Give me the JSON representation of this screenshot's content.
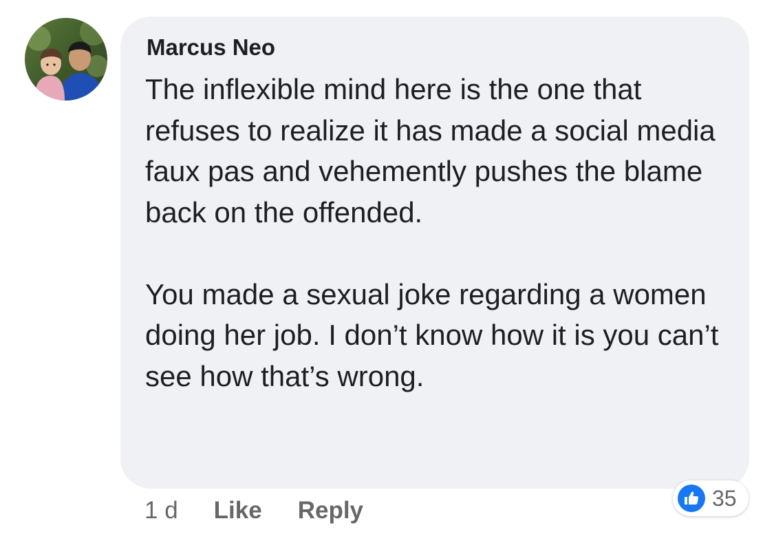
{
  "comment": {
    "author": "Marcus Neo",
    "paragraphs": [
      "The inflexible mind here is the one that refuses to realize it has made a social media faux pas and vehemently pushes the blame back on the offended.",
      "You made a sexual joke regarding a women doing her job. I don’t know how it is you can’t see how that’s wrong."
    ],
    "avatar_icon": "profile-photo"
  },
  "meta": {
    "time": "1 d",
    "like_label": "Like",
    "reply_label": "Reply"
  },
  "reactions": {
    "icon": "thumbs-up-icon",
    "count": "35",
    "color": "#1877f2"
  }
}
